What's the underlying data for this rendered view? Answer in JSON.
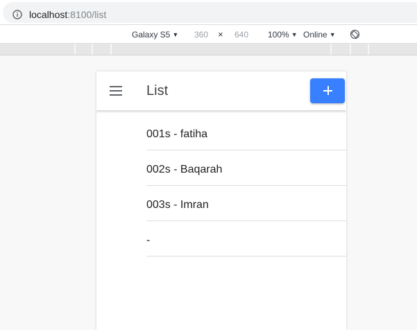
{
  "browser": {
    "url_host": "localhost",
    "url_path": ":8100/list"
  },
  "device_toolbar": {
    "device": "Galaxy S5",
    "width": "360",
    "separator": "×",
    "height": "640",
    "zoom": "100%",
    "network": "Online"
  },
  "app": {
    "title": "List",
    "items": [
      {
        "label": "001s - fatiha"
      },
      {
        "label": "002s - Baqarah"
      },
      {
        "label": "003s - Imran"
      },
      {
        "label": "-"
      }
    ]
  },
  "icons": {
    "info": "info-icon",
    "rotate": "rotate-icon",
    "menu": "menu-icon",
    "add": "plus-icon"
  },
  "colors": {
    "primary": "#3880ff",
    "page_background": "#f8f8f8",
    "divider": "#dedede"
  }
}
